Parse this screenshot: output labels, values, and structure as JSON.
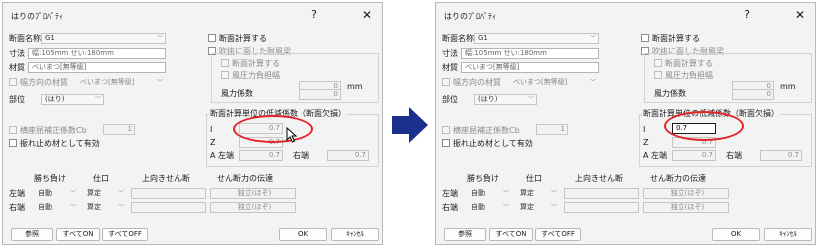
{
  "dialog": {
    "title": "はりのﾌﾟﾛﾊﾟﾃｨ",
    "help": "?",
    "close": "✕",
    "section_name_label": "断面名称",
    "section_name_value": "G1",
    "size_label": "寸法",
    "size_value": "幅:105mm せい:180mm",
    "material_label": "材質",
    "material_value": "べいまつ[無等級]",
    "width_material_label": "幅方向の材質",
    "width_material_value": "べいまつ[無等級]",
    "part_label": "部位",
    "part_value": "(はり)",
    "section_calc_label": "断面計算する",
    "wind_beam_label": "吹抜に面した耐風梁",
    "wind_section_calc_label": "断面計算する",
    "wind_width_label": "風圧力負担幅",
    "wind_width_value": "0",
    "wind_width_unit": "mm",
    "wind_coef_label": "風力係数",
    "wind_coef_value": "0",
    "lateral_label": "横座屈補正係数Cb",
    "lateral_value": "1",
    "bracing_label": "振れ止め材として有効",
    "coef_group_title": "断面計算単位の低減係数（断面欠損）",
    "coef_I_label": "I",
    "coef_Z_label": "Z",
    "coef_A_left_label": "A 左端",
    "coef_right_label": "右端",
    "coef_I_value": "0.7",
    "coef_Z_value": "0.7",
    "coef_A_left_value": "0.7",
    "coef_right_value": "0.7",
    "col_lap": "勝ち負け",
    "col_joint": "仕口",
    "col_upshear": "上向きせん断",
    "col_shear_transfer": "せん断力の伝達",
    "row_left": "左端",
    "row_right": "右端",
    "lap_value": "自動",
    "joint_value": "算定",
    "transfer_value": "独立(ほぞ)",
    "btn_ref": "参照",
    "btn_all_on": "すべてON",
    "btn_all_off": "すべてOFF",
    "btn_ok": "OK",
    "btn_cancel": "ｷｬﾝｾﾙ"
  },
  "after": {
    "coef_I_value": "0.7"
  },
  "colors": {
    "highlight_ring": "#e0242a",
    "arrow": "#1b2f8f"
  }
}
